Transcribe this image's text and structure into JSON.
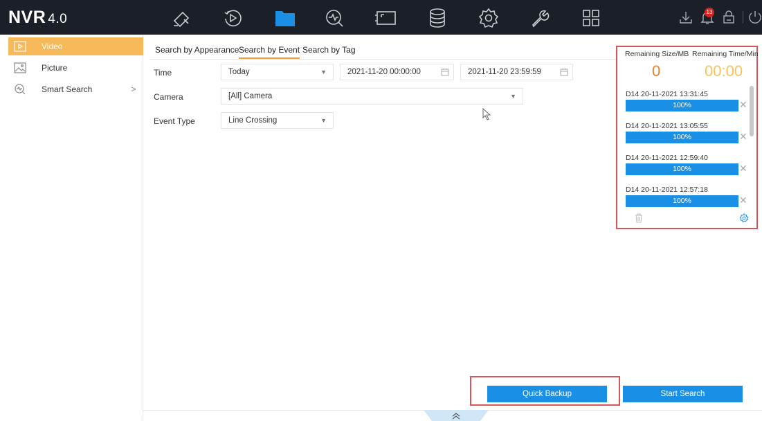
{
  "app": {
    "name": "NVR",
    "version": "4.0"
  },
  "topbar": {
    "nav_icons": [
      "camera-icon",
      "playback-icon",
      "file-management-icon",
      "smart-analysis-icon",
      "video-wall-icon",
      "storage-icon",
      "settings-icon",
      "maintenance-icon",
      "layout-grid-icon"
    ],
    "active_nav": "file-management-icon",
    "right_icons": [
      "download-icon",
      "alarm-bell-icon",
      "lock-icon",
      "power-icon"
    ],
    "alarm_count": "13",
    "accent_color": "#1a8fe6"
  },
  "sidebar": {
    "items": [
      {
        "label": "Video",
        "icon": "video-file-icon",
        "active": true
      },
      {
        "label": "Picture",
        "icon": "picture-icon",
        "active": false
      },
      {
        "label": "Smart Search",
        "icon": "smart-search-icon",
        "active": false,
        "chevron": ">"
      }
    ],
    "active_color": "#f7b95a"
  },
  "tabs": [
    {
      "label": "Search by Appearance",
      "active": false
    },
    {
      "label": "Search by Event",
      "active": true
    },
    {
      "label": "Search by Tag",
      "active": false
    }
  ],
  "form": {
    "time": {
      "label": "Time",
      "preset": "Today",
      "start": "2021-11-20 00:00:00",
      "end": "2021-11-20 23:59:59"
    },
    "camera": {
      "label": "Camera",
      "value": "[All] Camera"
    },
    "event_type": {
      "label": "Event Type",
      "value": "Line Crossing"
    }
  },
  "backup_panel": {
    "size_header": "Remaining Size/MB",
    "time_header": "Remaining Time/Min",
    "size_value": "0",
    "time_value": "00:00",
    "size_color": "#f07f2a",
    "time_color": "#f7c35a",
    "jobs": [
      {
        "name": "D14 20-11-2021 13:31:45",
        "progress": "100%",
        "progress_fraction": 1.0
      },
      {
        "name": "D14 20-11-2021 13:05:55",
        "progress": "100%",
        "progress_fraction": 1.0
      },
      {
        "name": "D14 20-11-2021 12:59:40",
        "progress": "100%",
        "progress_fraction": 1.0
      },
      {
        "name": "D14 20-11-2021 12:57:18",
        "progress": "100%",
        "progress_fraction": 1.0
      }
    ],
    "close_glyph": "✕"
  },
  "buttons": {
    "quick_backup": "Quick Backup",
    "start_search": "Start Search"
  },
  "highlight_color": "#d8545b"
}
